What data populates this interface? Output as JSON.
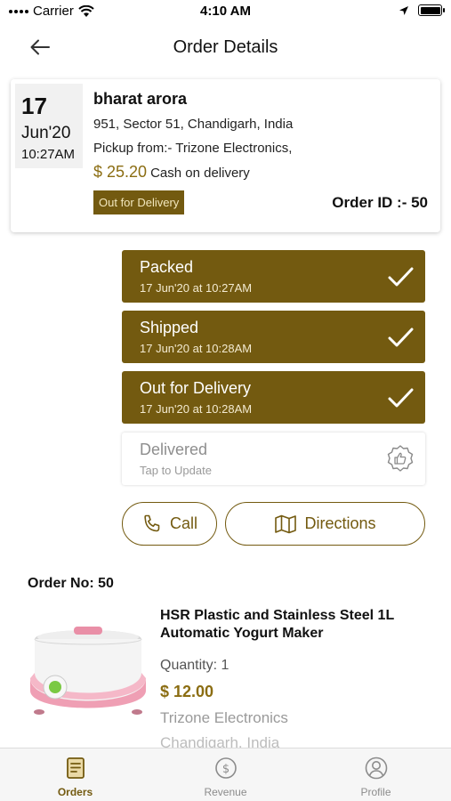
{
  "status_bar": {
    "carrier": "Carrier",
    "time": "4:10 AM",
    "icons": [
      "wifi-icon",
      "location-arrow-icon",
      "battery-icon"
    ]
  },
  "header": {
    "title": "Order Details",
    "back_icon": "arrow-left-icon"
  },
  "order": {
    "day": "17",
    "month_year": "Jun'20",
    "time": "10:27AM",
    "customer_name": "bharat arora",
    "address": "951, Sector 51, Chandigarh, India",
    "pickup": "Pickup from:- Trizone Electronics,",
    "amount": "$ 25.20",
    "payment_method": "Cash on delivery",
    "status": "Out for Delivery",
    "order_id": "Order ID :- 50"
  },
  "steps": [
    {
      "title": "Packed",
      "subtitle": "17 Jun'20 at 10:27AM",
      "done": true,
      "icon": "check-icon"
    },
    {
      "title": "Shipped",
      "subtitle": "17 Jun'20 at 10:28AM",
      "done": true,
      "icon": "check-icon"
    },
    {
      "title": "Out for Delivery",
      "subtitle": "17 Jun'20 at 10:28AM",
      "done": true,
      "icon": "check-icon"
    },
    {
      "title": "Delivered",
      "subtitle": "Tap to Update",
      "done": false,
      "icon": "thumbs-up-badge-icon"
    }
  ],
  "actions": {
    "call_label": "Call",
    "directions_label": "Directions"
  },
  "order_items": {
    "order_no": "Order No: 50",
    "items": [
      {
        "name": "HSR Plastic and Stainless Steel 1L Automatic Yogurt Maker",
        "quantity": "Quantity: 1",
        "price": "$ 12.00",
        "store": "Trizone Electronics",
        "location": "Chandigarh, India"
      }
    ]
  },
  "tabbar": {
    "tabs": [
      {
        "label": "Orders",
        "icon": "document-icon",
        "active": true
      },
      {
        "label": "Revenue",
        "icon": "dollar-circle-icon",
        "active": false
      },
      {
        "label": "Profile",
        "icon": "user-circle-icon",
        "active": false
      }
    ]
  },
  "colors": {
    "accent": "#735a10",
    "price": "#8b6d12",
    "muted": "#8e8e8e"
  }
}
